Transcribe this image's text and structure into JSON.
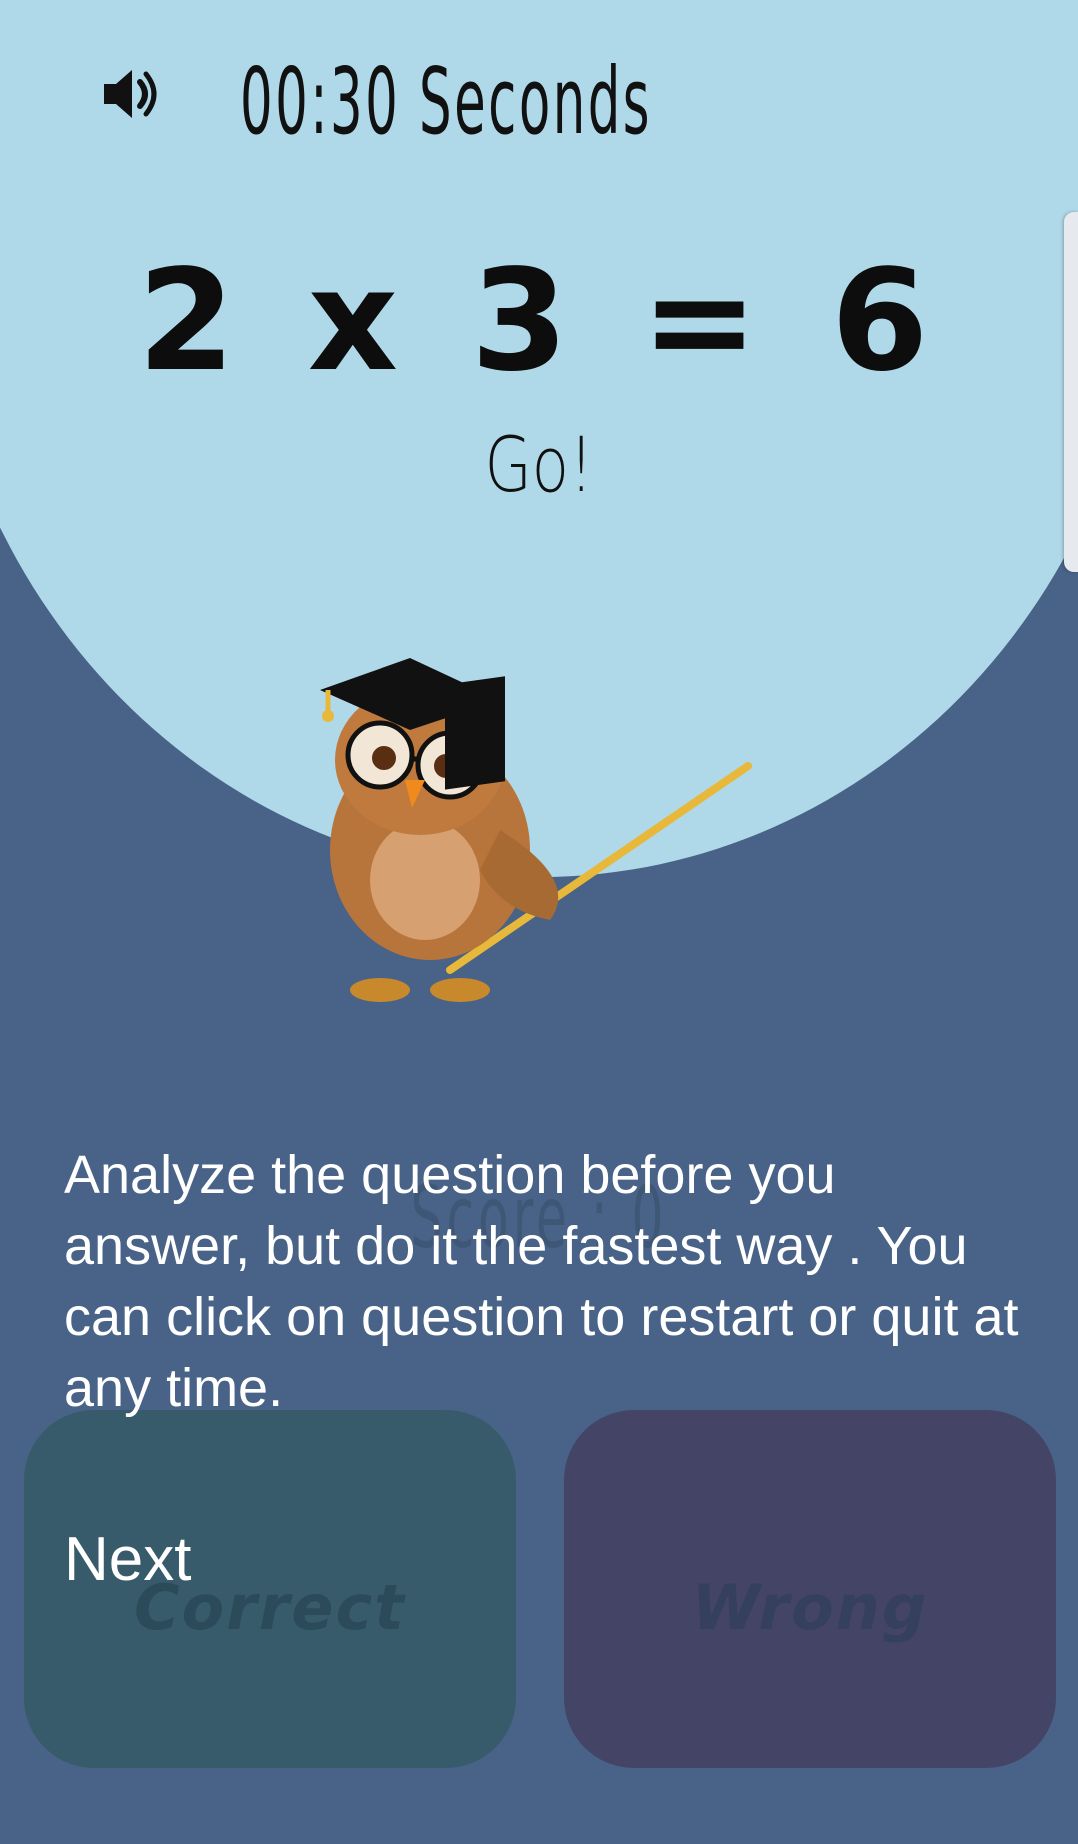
{
  "game": {
    "timer_text": "00:30 Seconds",
    "equation_text": "2 x 3 = 6",
    "status_text": "Go!",
    "score_text": "Score : 0"
  },
  "instructions": {
    "text": "Analyze the question before you answer, but do it the fastest way . You can click on question to restart or quit at any time."
  },
  "buttons": {
    "correct_label": "Correct",
    "wrong_label": "Wrong",
    "next_label": "Next"
  },
  "icons": {
    "sound": "speaker-icon",
    "mascot": "owl-teacher-icon"
  },
  "colors": {
    "background": "#486387",
    "circle": "#afd9e8",
    "correct_button": "#375b6b",
    "wrong_button": "#444466"
  }
}
